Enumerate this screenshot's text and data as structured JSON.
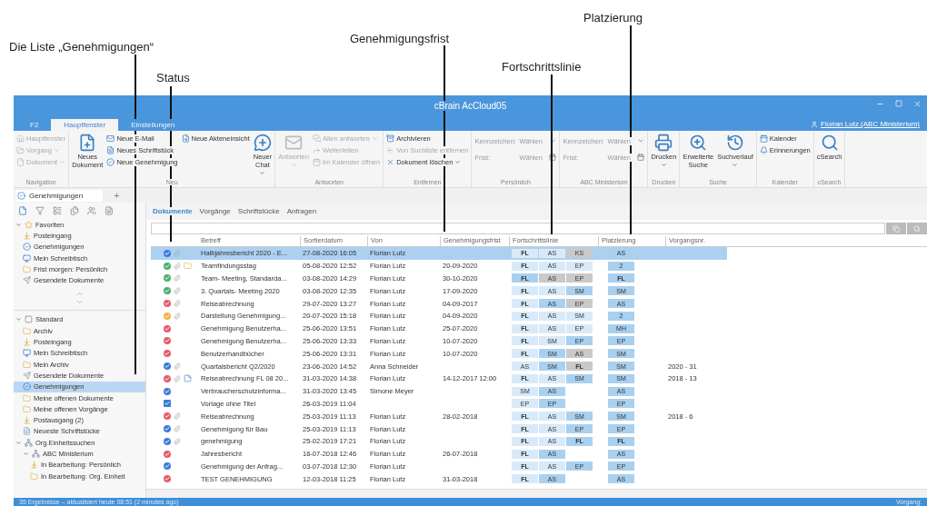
{
  "annotations": [
    {
      "text": "Platzierung"
    },
    {
      "text": "Genehmigungsfrist"
    },
    {
      "text": "Die Liste „Genehmigungen“"
    },
    {
      "text": "Fortschrittslinie"
    },
    {
      "text": "Status"
    }
  ],
  "window": {
    "title": "cBrain AcCloud05",
    "user": "Florian Lutz (ABC Ministerium)"
  },
  "tabs": [
    {
      "label": "F2",
      "selected": false
    },
    {
      "label": "Hauptfenster",
      "selected": true
    },
    {
      "label": "Einstellungen",
      "selected": false
    }
  ],
  "ribbon": [
    {
      "label": "Navigation",
      "columns": [
        [
          {
            "kind": "small",
            "label": "Hauptfenster",
            "disabled": true,
            "dropdown": false
          },
          {
            "kind": "small",
            "label": "Vorgang",
            "disabled": true,
            "dropdown": true
          },
          {
            "kind": "small",
            "label": "Dokument",
            "disabled": true,
            "dropdown": true
          }
        ]
      ]
    },
    {
      "label": "Neu",
      "columns": [
        [
          {
            "kind": "large",
            "label": "Neues\nDokument",
            "disabled": false,
            "dropdown": false
          }
        ],
        [
          {
            "kind": "small",
            "label": "Neue E-Mail",
            "disabled": false,
            "dropdown": false
          },
          {
            "kind": "small",
            "label": "Neues Schriftstück",
            "disabled": false,
            "dropdown": false
          },
          {
            "kind": "small",
            "label": "Neue Genehmigung",
            "disabled": false,
            "dropdown": false
          }
        ],
        [
          {
            "kind": "small",
            "label": "Neue Akteneinsicht",
            "disabled": false,
            "dropdown": false
          }
        ],
        [
          {
            "kind": "large",
            "label": "Neuer\nChat",
            "disabled": false,
            "dropdown": true
          }
        ]
      ]
    },
    {
      "label": "Antworten",
      "columns": [
        [
          {
            "kind": "large",
            "label": "Antworten",
            "disabled": true,
            "dropdown": true
          }
        ],
        [
          {
            "kind": "small",
            "label": "Allen antworten",
            "disabled": true,
            "dropdown": true
          },
          {
            "kind": "small",
            "label": "Weiterleiten",
            "disabled": true,
            "dropdown": false
          },
          {
            "kind": "small",
            "label": "Im Kalender öffnen",
            "disabled": true,
            "dropdown": false
          }
        ]
      ]
    },
    {
      "label": "Entfernen",
      "columns": [
        [
          {
            "kind": "small",
            "label": "Archivieren",
            "disabled": false,
            "dropdown": false
          },
          {
            "kind": "small",
            "label": "Von Suchliste entfernen",
            "disabled": true,
            "dropdown": false
          },
          {
            "kind": "small",
            "label": "Dokument löschen",
            "disabled": false,
            "dropdown": true
          }
        ]
      ]
    },
    {
      "label": "Persönlich",
      "columns": [
        [
          {
            "kind": "field",
            "label": "Kennzeichen:",
            "value": "Wählen",
            "disabled": true,
            "dropdown": true
          },
          {
            "kind": "field",
            "label": "Frist:",
            "value": "Wählen",
            "disabled": true,
            "dropdown": false
          }
        ]
      ]
    },
    {
      "label": "ABC Ministerium",
      "columns": [
        [
          {
            "kind": "field",
            "label": "Kennzeichen:",
            "value": "Wählen",
            "disabled": true,
            "dropdown": true
          },
          {
            "kind": "field",
            "label": "Frist:",
            "value": "Wählen",
            "disabled": true,
            "dropdown": false
          }
        ]
      ]
    },
    {
      "label": "Drucken",
      "columns": [
        [
          {
            "kind": "large",
            "label": "Drucken",
            "disabled": false,
            "dropdown": true
          }
        ]
      ]
    },
    {
      "label": "Suche",
      "columns": [
        [
          {
            "kind": "large",
            "label": "Erweiterte\nSuche",
            "disabled": false,
            "dropdown": false
          }
        ],
        [
          {
            "kind": "large",
            "label": "Suchverlauf",
            "disabled": false,
            "dropdown": true
          }
        ]
      ]
    },
    {
      "label": "Kalender",
      "columns": [
        [
          {
            "kind": "small",
            "label": "Kalender",
            "disabled": false,
            "dropdown": false
          },
          {
            "kind": "small",
            "label": "Erinnerungen",
            "disabled": false,
            "dropdown": false
          }
        ]
      ]
    },
    {
      "label": "cSearch",
      "columns": [
        [
          {
            "kind": "large",
            "label": "cSearch",
            "disabled": false,
            "dropdown": false
          }
        ]
      ]
    }
  ],
  "doc_tab": {
    "label": "Genehmigungen",
    "add": "+"
  },
  "sidebar": [
    {
      "label": "Favoriten",
      "kind": "favorites",
      "selected": false,
      "expanded": true,
      "children": [
        {
          "label": "Posteingang",
          "kind": "inbox",
          "selected": false
        },
        {
          "label": "Genehmigungen",
          "kind": "approvals",
          "selected": false
        },
        {
          "label": "Mein Schreibtisch",
          "kind": "desk",
          "selected": false
        },
        {
          "label": "Frist morgen: Persönlich",
          "kind": "folder",
          "selected": false
        },
        {
          "label": "Gesendete Dokumente",
          "kind": "sent",
          "selected": false
        }
      ]
    },
    {
      "label": "Standard",
      "kind": "group",
      "selected": false,
      "expanded": true,
      "children": [
        {
          "label": "Archiv",
          "kind": "folder",
          "selected": false
        },
        {
          "label": "Posteingang",
          "kind": "inbox",
          "selected": false
        },
        {
          "label": "Mein Schreibtisch",
          "kind": "desk",
          "selected": false
        },
        {
          "label": "Mein Archiv",
          "kind": "folder",
          "selected": false
        },
        {
          "label": "Gesendete Dokumente",
          "kind": "sent",
          "selected": false
        },
        {
          "label": "Genehmigungen",
          "kind": "approvals",
          "selected": true
        },
        {
          "label": "Meine offenen Dokumente",
          "kind": "folder",
          "selected": false
        },
        {
          "label": "Meine offenen Vorgänge",
          "kind": "folder",
          "selected": false
        },
        {
          "label": "Postausgang (2)",
          "kind": "inbox",
          "selected": false
        },
        {
          "label": "Neueste Schriftstücke",
          "kind": "document",
          "selected": false
        }
      ]
    },
    {
      "label": "Org.Einheitssuchen",
      "kind": "unit",
      "selected": false,
      "expanded": true,
      "children": [
        {
          "label": "ABC Ministerium",
          "kind": "unit",
          "selected": false,
          "expanded": true,
          "children": [
            {
              "label": "In Bearbeitung: Persönlich",
              "kind": "inbox",
              "selected": false
            },
            {
              "label": "In Bearbeitung: Org. Einheit",
              "kind": "folder",
              "selected": false
            }
          ]
        }
      ]
    }
  ],
  "subtabs": [
    {
      "label": "Dokumente",
      "selected": true
    },
    {
      "label": "Vorgänge",
      "selected": false
    },
    {
      "label": "Schriftstücke",
      "selected": false
    },
    {
      "label": "Anfragen",
      "selected": false
    }
  ],
  "table": {
    "columns": [
      "Betreff",
      "Sortierdatum",
      "Von",
      "Genehmigungsfrist",
      "Fortschrittslinie",
      "Platzierung",
      "Vorgangsnr."
    ],
    "rows": [
      {
        "selected": true,
        "status": {
          "kind": "circle",
          "color": "#3b7dd8"
        },
        "attachment": true,
        "kind": "plain",
        "betreff": "Halbjahresbericht 2020 - E...",
        "datum": "27-08-2020 16:05",
        "von": "Florian Lutz",
        "frist": "",
        "progress": [
          {
            "label": "FL",
            "kind": "light",
            "bold": true
          },
          {
            "label": "AS",
            "kind": "light",
            "bold": false
          },
          {
            "label": "KS",
            "kind": "grey",
            "bold": false
          }
        ],
        "platz": "AS",
        "platz_bold": false,
        "nr": ""
      },
      {
        "selected": false,
        "status": {
          "kind": "circle",
          "color": "#4caf6a"
        },
        "attachment": true,
        "kind": "folder",
        "betreff": "Teamfindungsstag",
        "datum": "05-08-2020 12:52",
        "von": "Florian Lutz",
        "frist": "20-09-2020",
        "progress": [
          {
            "label": "FL",
            "kind": "light",
            "bold": true
          },
          {
            "label": "AS",
            "kind": "light",
            "bold": false
          },
          {
            "label": "EP",
            "kind": "light",
            "bold": false
          }
        ],
        "platz": "2",
        "platz_bold": false,
        "nr": ""
      },
      {
        "selected": false,
        "status": {
          "kind": "circle",
          "color": "#4caf6a"
        },
        "attachment": true,
        "kind": "plain",
        "betreff": "Team- Meeting, Standarda...",
        "datum": "03-08-2020 14:29",
        "von": "Florian Lutz",
        "frist": "30-10-2020",
        "progress": [
          {
            "label": "FL",
            "kind": "blue",
            "bold": true
          },
          {
            "label": "AS",
            "kind": "grey",
            "bold": false
          },
          {
            "label": "EP",
            "kind": "grey",
            "bold": false
          }
        ],
        "platz": "FL",
        "platz_bold": true,
        "nr": ""
      },
      {
        "selected": false,
        "status": {
          "kind": "circle",
          "color": "#4caf6a"
        },
        "attachment": true,
        "kind": "plain",
        "betreff": "3. Quartals- Meeting 2020",
        "datum": "03-08-2020 12:35",
        "von": "Florian Lutz",
        "frist": "17-09-2020",
        "progress": [
          {
            "label": "FL",
            "kind": "light",
            "bold": true
          },
          {
            "label": "AS",
            "kind": "light",
            "bold": false
          },
          {
            "label": "SM",
            "kind": "blue",
            "bold": false
          }
        ],
        "platz": "SM",
        "platz_bold": false,
        "nr": ""
      },
      {
        "selected": false,
        "status": {
          "kind": "circle",
          "color": "#e35d6a"
        },
        "attachment": true,
        "kind": "plain",
        "betreff": "Reiseabrechnung",
        "datum": "29-07-2020 13:27",
        "von": "Florian Lutz",
        "frist": "04-09-2017",
        "progress": [
          {
            "label": "FL",
            "kind": "light",
            "bold": true
          },
          {
            "label": "AS",
            "kind": "blue",
            "bold": false
          },
          {
            "label": "EP",
            "kind": "grey",
            "bold": false
          }
        ],
        "platz": "AS",
        "platz_bold": false,
        "nr": ""
      },
      {
        "selected": false,
        "status": {
          "kind": "circle",
          "color": "#f2b33d"
        },
        "attachment": true,
        "kind": "plain",
        "betreff": "Darstellung Genehmigung...",
        "datum": "20-07-2020 15:18",
        "von": "Florian Lutz",
        "frist": "04-09-2020",
        "progress": [
          {
            "label": "FL",
            "kind": "light",
            "bold": true
          },
          {
            "label": "AS",
            "kind": "light",
            "bold": false
          },
          {
            "label": "SM",
            "kind": "light",
            "bold": false
          }
        ],
        "platz": "2",
        "platz_bold": false,
        "nr": ""
      },
      {
        "selected": false,
        "status": {
          "kind": "circle",
          "color": "#e35d6a"
        },
        "attachment": false,
        "kind": "plain",
        "betreff": "Genehmigung Benutzerha...",
        "datum": "25-06-2020 13:51",
        "von": "Florian Lutz",
        "frist": "25-07-2020",
        "progress": [
          {
            "label": "FL",
            "kind": "light",
            "bold": true
          },
          {
            "label": "AS",
            "kind": "light",
            "bold": false
          },
          {
            "label": "EP",
            "kind": "light",
            "bold": false
          }
        ],
        "platz": "MH",
        "platz_bold": false,
        "nr": ""
      },
      {
        "selected": false,
        "status": {
          "kind": "circle",
          "color": "#e35d6a"
        },
        "attachment": false,
        "kind": "plain",
        "betreff": "Genehmigung Benutzerha...",
        "datum": "25-06-2020 13:33",
        "von": "Florian Lutz",
        "frist": "10-07-2020",
        "progress": [
          {
            "label": "FL",
            "kind": "light",
            "bold": true
          },
          {
            "label": "SM",
            "kind": "light",
            "bold": false
          },
          {
            "label": "EP",
            "kind": "blue",
            "bold": false
          }
        ],
        "platz": "EP",
        "platz_bold": false,
        "nr": ""
      },
      {
        "selected": false,
        "status": {
          "kind": "circle",
          "color": "#e35d6a"
        },
        "attachment": false,
        "kind": "plain",
        "betreff": "Benutzerhandbücher",
        "datum": "25-06-2020 13:31",
        "von": "Florian Lutz",
        "frist": "10-07-2020",
        "progress": [
          {
            "label": "FL",
            "kind": "light",
            "bold": true
          },
          {
            "label": "SM",
            "kind": "blue",
            "bold": false
          },
          {
            "label": "AS",
            "kind": "grey",
            "bold": false
          }
        ],
        "platz": "SM",
        "platz_bold": false,
        "nr": ""
      },
      {
        "selected": false,
        "status": {
          "kind": "circle",
          "color": "#3b7dd8"
        },
        "attachment": true,
        "kind": "plain",
        "betreff": "Quartalsbericht Q2/2020",
        "datum": "23-06-2020 14:52",
        "von": "Anna Schneider",
        "frist": "",
        "progress": [
          {
            "label": "AS",
            "kind": "light",
            "bold": false
          },
          {
            "label": "SM",
            "kind": "blue",
            "bold": false
          },
          {
            "label": "FL",
            "kind": "grey",
            "bold": true
          }
        ],
        "platz": "SM",
        "platz_bold": false,
        "nr": "2020 - 31"
      },
      {
        "selected": false,
        "status": {
          "kind": "circle",
          "color": "#e35d6a"
        },
        "attachment": true,
        "kind": "note",
        "betreff": "Reiseabrechnung FL 08 20...",
        "datum": "31-03-2020 14:38",
        "von": "Florian Lutz",
        "frist": "14-12-2017 12:00",
        "progress": [
          {
            "label": "FL",
            "kind": "light",
            "bold": true
          },
          {
            "label": "AS",
            "kind": "light",
            "bold": false
          },
          {
            "label": "SM",
            "kind": "blue",
            "bold": false
          }
        ],
        "platz": "SM",
        "platz_bold": false,
        "nr": "2018 - 13"
      },
      {
        "selected": false,
        "status": {
          "kind": "circle",
          "color": "#3b7dd8"
        },
        "attachment": false,
        "kind": "plain",
        "betreff": "Verbraucherschutzinforma...",
        "datum": "31-03-2020 13:45",
        "von": "Simone Meyer",
        "frist": "",
        "progress": [
          {
            "label": "SM",
            "kind": "light",
            "bold": false
          },
          {
            "label": "AS",
            "kind": "blue",
            "bold": false
          }
        ],
        "platz": "AS",
        "platz_bold": false,
        "nr": ""
      },
      {
        "selected": false,
        "status": {
          "kind": "square",
          "color": "#3b7dd8"
        },
        "attachment": false,
        "kind": "plain",
        "betreff": "Vorlage ohne Titel",
        "datum": "26-03-2019 11:04",
        "von": "",
        "frist": "",
        "progress": [
          {
            "label": "EP",
            "kind": "light",
            "bold": false
          },
          {
            "label": "EP",
            "kind": "blue",
            "bold": false
          }
        ],
        "platz": "EP",
        "platz_bold": false,
        "nr": ""
      },
      {
        "selected": false,
        "status": {
          "kind": "circle",
          "color": "#e35d6a"
        },
        "attachment": true,
        "kind": "plain",
        "betreff": "Reiseabrechnung",
        "datum": "25-03-2019 11:13",
        "von": "Florian Lutz",
        "frist": "28-02-2018",
        "progress": [
          {
            "label": "FL",
            "kind": "light",
            "bold": true
          },
          {
            "label": "AS",
            "kind": "light",
            "bold": false
          },
          {
            "label": "SM",
            "kind": "blue",
            "bold": false
          }
        ],
        "platz": "SM",
        "platz_bold": false,
        "nr": "2018 - 6"
      },
      {
        "selected": false,
        "status": {
          "kind": "circle",
          "color": "#3b7dd8"
        },
        "attachment": true,
        "kind": "plain",
        "betreff": "Genehmigung für Bau",
        "datum": "25-03-2019 11:13",
        "von": "Florian Lutz",
        "frist": "",
        "progress": [
          {
            "label": "FL",
            "kind": "light",
            "bold": true
          },
          {
            "label": "AS",
            "kind": "light",
            "bold": false
          },
          {
            "label": "EP",
            "kind": "blue",
            "bold": false
          }
        ],
        "platz": "EP",
        "platz_bold": false,
        "nr": ""
      },
      {
        "selected": false,
        "status": {
          "kind": "circle",
          "color": "#3b7dd8"
        },
        "attachment": true,
        "kind": "plain",
        "betreff": "genehmigung",
        "datum": "25-02-2019 17:21",
        "von": "Florian Lutz",
        "frist": "",
        "progress": [
          {
            "label": "FL",
            "kind": "light",
            "bold": true
          },
          {
            "label": "AS",
            "kind": "light",
            "bold": false
          },
          {
            "label": "FL",
            "kind": "blue",
            "bold": true
          }
        ],
        "platz": "FL",
        "platz_bold": true,
        "nr": ""
      },
      {
        "selected": false,
        "status": {
          "kind": "circle",
          "color": "#e35d6a"
        },
        "attachment": false,
        "kind": "plain",
        "betreff": "Jahresbericht",
        "datum": "16-07-2018 12:46",
        "von": "Florian Lutz",
        "frist": "26-07-2018",
        "progress": [
          {
            "label": "FL",
            "kind": "light",
            "bold": true
          },
          {
            "label": "AS",
            "kind": "blue",
            "bold": false
          }
        ],
        "platz": "AS",
        "platz_bold": false,
        "nr": ""
      },
      {
        "selected": false,
        "status": {
          "kind": "circle",
          "color": "#3b7dd8"
        },
        "attachment": false,
        "kind": "plain",
        "betreff": "Genehmigung der Anfrag...",
        "datum": "03-07-2018 12:30",
        "von": "Florian Lutz",
        "frist": "",
        "progress": [
          {
            "label": "FL",
            "kind": "light",
            "bold": true
          },
          {
            "label": "AS",
            "kind": "light",
            "bold": false
          },
          {
            "label": "EP",
            "kind": "blue",
            "bold": false
          }
        ],
        "platz": "EP",
        "platz_bold": false,
        "nr": ""
      },
      {
        "selected": false,
        "status": {
          "kind": "circle",
          "color": "#e35d6a"
        },
        "attachment": false,
        "kind": "plain",
        "betreff": "TEST GENEHMIGUNG",
        "datum": "12-03-2018 11:25",
        "von": "Florian Lutz",
        "frist": "31-03-2018",
        "progress": [
          {
            "label": "FL",
            "kind": "light",
            "bold": true
          },
          {
            "label": "AS",
            "kind": "blue",
            "bold": false
          }
        ],
        "platz": "AS",
        "platz_bold": false,
        "nr": ""
      }
    ]
  },
  "status_bar": {
    "text": "35 Ergebnisse – aktualisiert heute 08:51 (2 minutes ago)",
    "right": "Vorgang:"
  }
}
